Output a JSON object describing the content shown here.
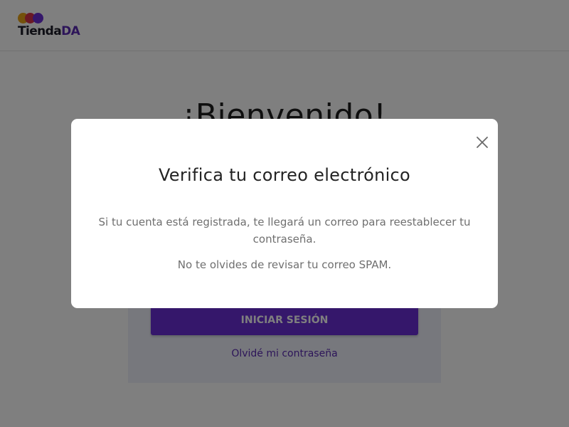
{
  "header": {
    "logo_text_main": "Tienda",
    "logo_text_accent": "DA",
    "logo_dot_colors": [
      "#e8a317",
      "#d6334a",
      "#6b2fd6"
    ]
  },
  "background": {
    "welcome_title": "¡Bienvenido!",
    "login_button_label": "INICIAR SESIÓN",
    "forgot_password_link": "Olvidé mi contraseña"
  },
  "modal": {
    "title": "Verifica tu correo electrónico",
    "message": "Si tu cuenta está registrada, te llegará un correo para reestablecer tu contraseña.",
    "spam_note": "No te olvides de revisar tu correo SPAM.",
    "close_icon": "close-icon"
  },
  "colors": {
    "brand_purple": "#6b2fd6",
    "overlay": "rgba(0,0,0,0.5)"
  }
}
